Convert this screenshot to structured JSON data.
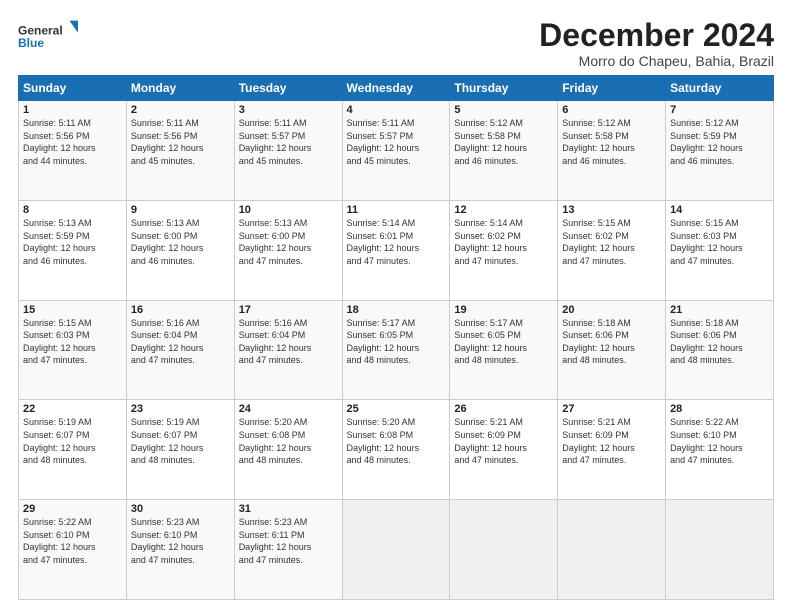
{
  "logo": {
    "line1": "General",
    "line2": "Blue"
  },
  "title": "December 2024",
  "subtitle": "Morro do Chapeu, Bahia, Brazil",
  "days_of_week": [
    "Sunday",
    "Monday",
    "Tuesday",
    "Wednesday",
    "Thursday",
    "Friday",
    "Saturday"
  ],
  "weeks": [
    [
      {
        "day": 1,
        "info": "Sunrise: 5:11 AM\nSunset: 5:56 PM\nDaylight: 12 hours\nand 44 minutes."
      },
      {
        "day": 2,
        "info": "Sunrise: 5:11 AM\nSunset: 5:56 PM\nDaylight: 12 hours\nand 45 minutes."
      },
      {
        "day": 3,
        "info": "Sunrise: 5:11 AM\nSunset: 5:57 PM\nDaylight: 12 hours\nand 45 minutes."
      },
      {
        "day": 4,
        "info": "Sunrise: 5:11 AM\nSunset: 5:57 PM\nDaylight: 12 hours\nand 45 minutes."
      },
      {
        "day": 5,
        "info": "Sunrise: 5:12 AM\nSunset: 5:58 PM\nDaylight: 12 hours\nand 46 minutes."
      },
      {
        "day": 6,
        "info": "Sunrise: 5:12 AM\nSunset: 5:58 PM\nDaylight: 12 hours\nand 46 minutes."
      },
      {
        "day": 7,
        "info": "Sunrise: 5:12 AM\nSunset: 5:59 PM\nDaylight: 12 hours\nand 46 minutes."
      }
    ],
    [
      {
        "day": 8,
        "info": "Sunrise: 5:13 AM\nSunset: 5:59 PM\nDaylight: 12 hours\nand 46 minutes."
      },
      {
        "day": 9,
        "info": "Sunrise: 5:13 AM\nSunset: 6:00 PM\nDaylight: 12 hours\nand 46 minutes."
      },
      {
        "day": 10,
        "info": "Sunrise: 5:13 AM\nSunset: 6:00 PM\nDaylight: 12 hours\nand 47 minutes."
      },
      {
        "day": 11,
        "info": "Sunrise: 5:14 AM\nSunset: 6:01 PM\nDaylight: 12 hours\nand 47 minutes."
      },
      {
        "day": 12,
        "info": "Sunrise: 5:14 AM\nSunset: 6:02 PM\nDaylight: 12 hours\nand 47 minutes."
      },
      {
        "day": 13,
        "info": "Sunrise: 5:15 AM\nSunset: 6:02 PM\nDaylight: 12 hours\nand 47 minutes."
      },
      {
        "day": 14,
        "info": "Sunrise: 5:15 AM\nSunset: 6:03 PM\nDaylight: 12 hours\nand 47 minutes."
      }
    ],
    [
      {
        "day": 15,
        "info": "Sunrise: 5:15 AM\nSunset: 6:03 PM\nDaylight: 12 hours\nand 47 minutes."
      },
      {
        "day": 16,
        "info": "Sunrise: 5:16 AM\nSunset: 6:04 PM\nDaylight: 12 hours\nand 47 minutes."
      },
      {
        "day": 17,
        "info": "Sunrise: 5:16 AM\nSunset: 6:04 PM\nDaylight: 12 hours\nand 47 minutes."
      },
      {
        "day": 18,
        "info": "Sunrise: 5:17 AM\nSunset: 6:05 PM\nDaylight: 12 hours\nand 48 minutes."
      },
      {
        "day": 19,
        "info": "Sunrise: 5:17 AM\nSunset: 6:05 PM\nDaylight: 12 hours\nand 48 minutes."
      },
      {
        "day": 20,
        "info": "Sunrise: 5:18 AM\nSunset: 6:06 PM\nDaylight: 12 hours\nand 48 minutes."
      },
      {
        "day": 21,
        "info": "Sunrise: 5:18 AM\nSunset: 6:06 PM\nDaylight: 12 hours\nand 48 minutes."
      }
    ],
    [
      {
        "day": 22,
        "info": "Sunrise: 5:19 AM\nSunset: 6:07 PM\nDaylight: 12 hours\nand 48 minutes."
      },
      {
        "day": 23,
        "info": "Sunrise: 5:19 AM\nSunset: 6:07 PM\nDaylight: 12 hours\nand 48 minutes."
      },
      {
        "day": 24,
        "info": "Sunrise: 5:20 AM\nSunset: 6:08 PM\nDaylight: 12 hours\nand 48 minutes."
      },
      {
        "day": 25,
        "info": "Sunrise: 5:20 AM\nSunset: 6:08 PM\nDaylight: 12 hours\nand 48 minutes."
      },
      {
        "day": 26,
        "info": "Sunrise: 5:21 AM\nSunset: 6:09 PM\nDaylight: 12 hours\nand 47 minutes."
      },
      {
        "day": 27,
        "info": "Sunrise: 5:21 AM\nSunset: 6:09 PM\nDaylight: 12 hours\nand 47 minutes."
      },
      {
        "day": 28,
        "info": "Sunrise: 5:22 AM\nSunset: 6:10 PM\nDaylight: 12 hours\nand 47 minutes."
      }
    ],
    [
      {
        "day": 29,
        "info": "Sunrise: 5:22 AM\nSunset: 6:10 PM\nDaylight: 12 hours\nand 47 minutes."
      },
      {
        "day": 30,
        "info": "Sunrise: 5:23 AM\nSunset: 6:10 PM\nDaylight: 12 hours\nand 47 minutes."
      },
      {
        "day": 31,
        "info": "Sunrise: 5:23 AM\nSunset: 6:11 PM\nDaylight: 12 hours\nand 47 minutes."
      },
      null,
      null,
      null,
      null
    ]
  ]
}
